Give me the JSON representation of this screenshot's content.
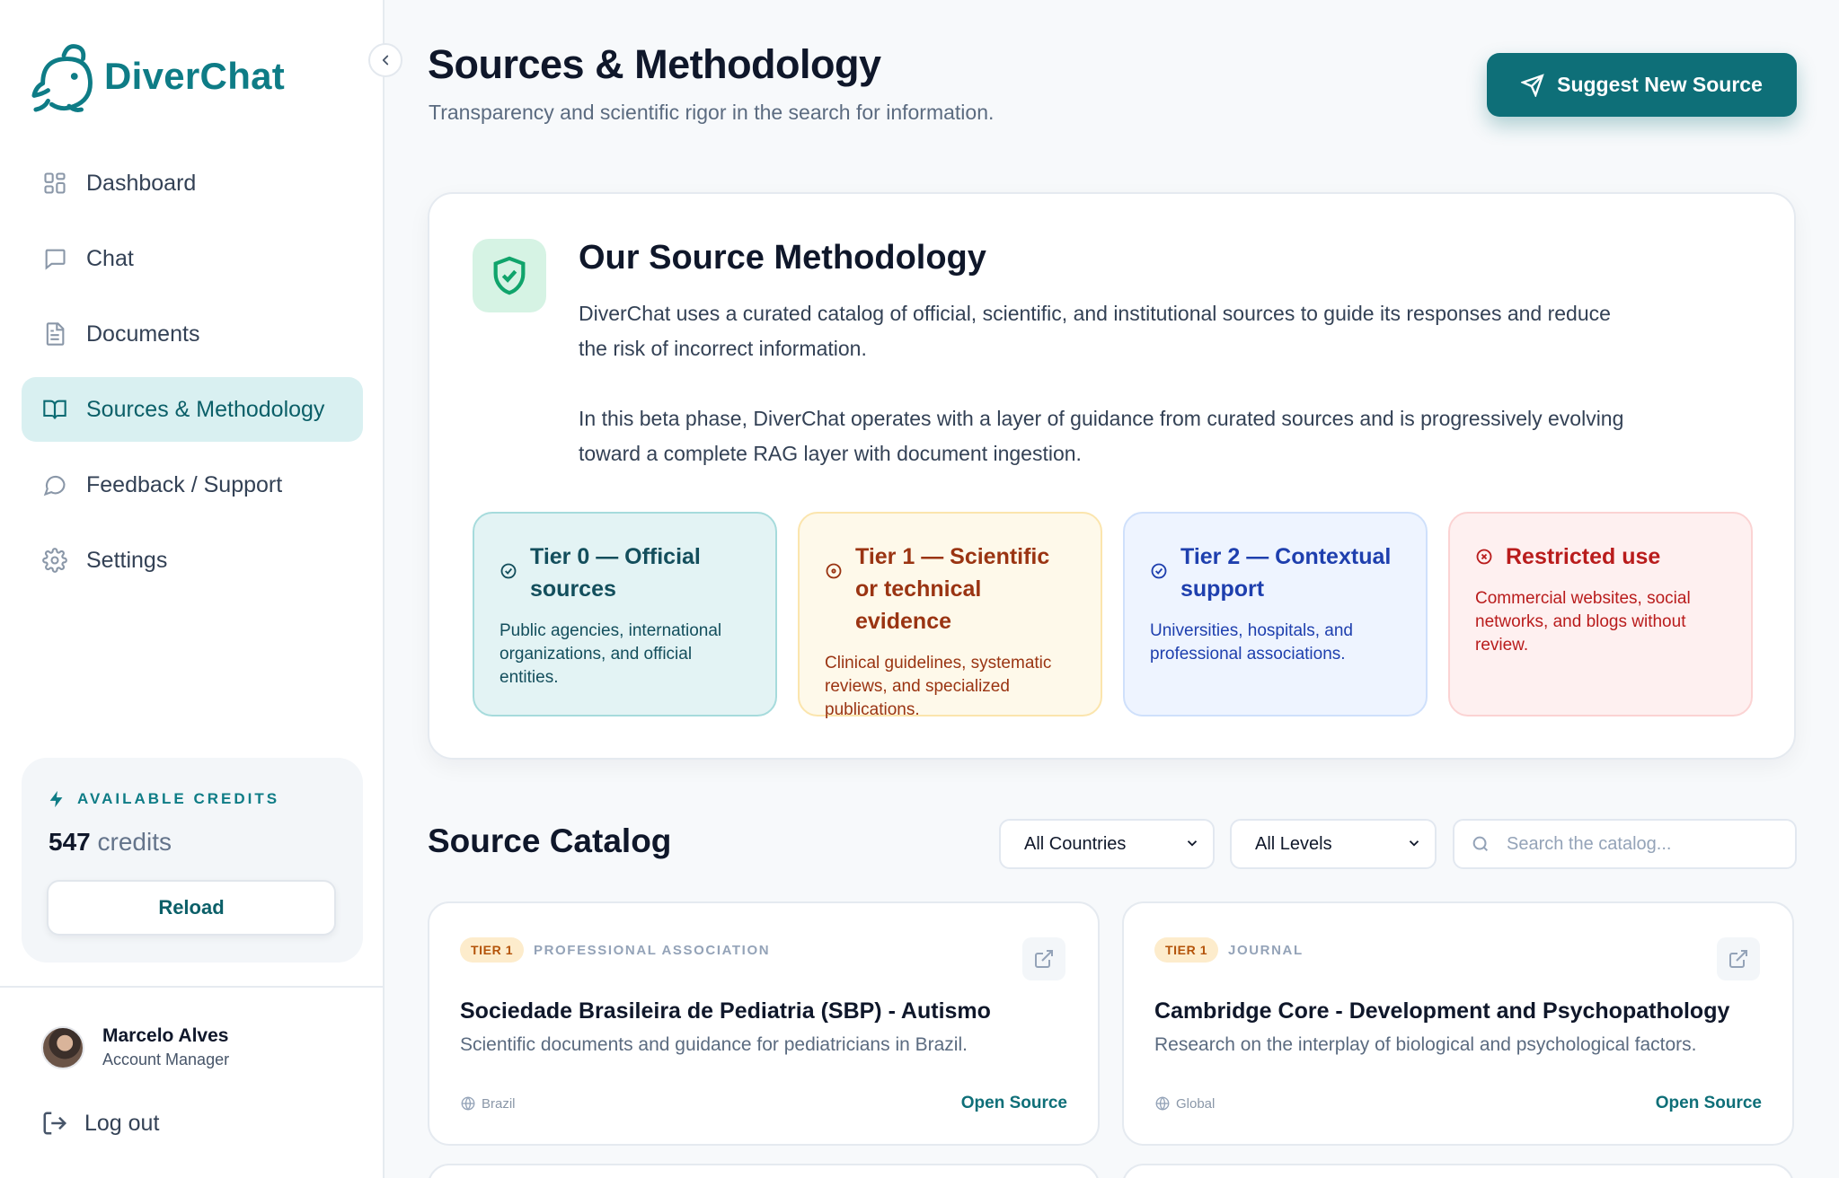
{
  "app": {
    "name": "DiverChat"
  },
  "sidebar": {
    "items": [
      {
        "label": "Dashboard",
        "icon": "grid-icon"
      },
      {
        "label": "Chat",
        "icon": "chat-icon"
      },
      {
        "label": "Documents",
        "icon": "document-icon"
      },
      {
        "label": "Sources & Methodology",
        "icon": "book-icon",
        "active": true
      },
      {
        "label": "Feedback / Support",
        "icon": "message-circle-icon"
      },
      {
        "label": "Settings",
        "icon": "gear-icon"
      }
    ],
    "credits": {
      "label": "AVAILABLE CREDITS",
      "value": "547",
      "unit": "credits",
      "reload_label": "Reload"
    },
    "user": {
      "name": "Marcelo Alves",
      "role": "Account Manager"
    },
    "logout_label": "Log out"
  },
  "header": {
    "title": "Sources & Methodology",
    "subtitle": "Transparency and scientific rigor in the search for information.",
    "suggest_button": "Suggest New Source"
  },
  "methodology": {
    "title": "Our Source Methodology",
    "paragraph1": "DiverChat uses a curated catalog of official, scientific, and institutional sources to guide its responses and reduce the risk of incorrect information.",
    "paragraph2": "In this beta phase, DiverChat operates with a layer of guidance from curated sources and is progressively evolving toward a complete RAG layer with document ingestion.",
    "tiers": [
      {
        "title": "Tier 0 — Official sources",
        "description": "Public agencies, international organizations, and official entities."
      },
      {
        "title": "Tier 1 — Scientific or technical evidence",
        "description": "Clinical guidelines, systematic reviews, and specialized publications."
      },
      {
        "title": "Tier 2 — Contextual support",
        "description": "Universities, hospitals, and professional associations."
      },
      {
        "title": "Restricted use",
        "description": "Commercial websites, social networks, and blogs without review."
      }
    ]
  },
  "catalog": {
    "title": "Source Catalog",
    "country_filter": "All Countries",
    "level_filter": "All Levels",
    "search_placeholder": "Search the catalog...",
    "sources": [
      {
        "tier": "TIER 1",
        "type": "PROFESSIONAL ASSOCIATION",
        "name": "Sociedade Brasileira de Pediatria (SBP) - Autismo",
        "description": "Scientific documents and guidance for pediatricians in Brazil.",
        "region": "Brazil",
        "link_label": "Open Source"
      },
      {
        "tier": "TIER 1",
        "type": "JOURNAL",
        "name": "Cambridge Core - Development and Psychopathology",
        "description": "Research on the interplay of biological and psychological factors.",
        "region": "Global",
        "link_label": "Open Source"
      }
    ]
  },
  "colors": {
    "brand": "#0e7c86",
    "primary_button": "#0e6f78",
    "active_nav_bg": "#d9f0f1"
  }
}
